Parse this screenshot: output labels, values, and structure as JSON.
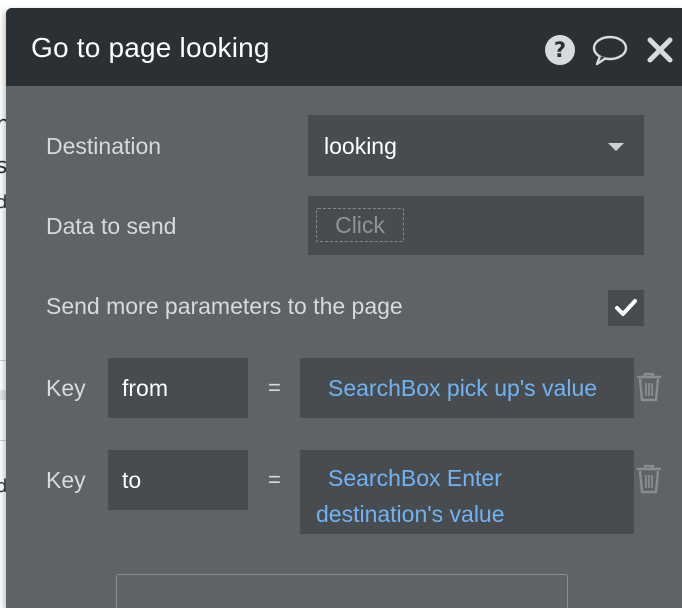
{
  "background": {
    "fragments": [
      "h",
      "s",
      "d",
      "d"
    ]
  },
  "dialog": {
    "title": "Go to page looking",
    "icons": {
      "help": "help-icon",
      "comment": "comment-icon",
      "close": "close-icon"
    }
  },
  "form": {
    "destination_label": "Destination",
    "destination_value": "looking",
    "data_to_send_label": "Data to send",
    "click_placeholder": "Click",
    "send_more_label": "Send more parameters to the page",
    "send_more_checked": true,
    "parameters": [
      {
        "key_label": "Key",
        "key": "from",
        "equals": "=",
        "value": "SearchBox pick up's value"
      },
      {
        "key_label": "Key",
        "key": "to",
        "equals": "=",
        "value": "SearchBox Enter destination's value"
      }
    ]
  },
  "colors": {
    "header_bg": "#2b3034",
    "panel_bg": "#5f6366",
    "field_bg": "#484c4f",
    "dynamic_value": "#6fb3f6"
  }
}
